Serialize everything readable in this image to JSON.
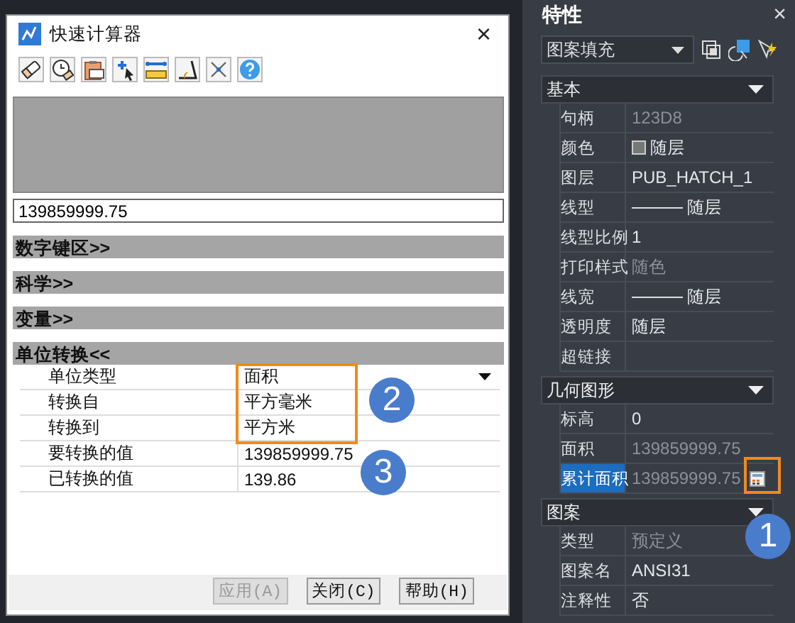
{
  "calculator": {
    "title": "快速计算器",
    "close_glyph": "×",
    "display_value": "139859999.75",
    "sections": [
      {
        "label": "数字键区>>"
      },
      {
        "label": "科学>>"
      },
      {
        "label": "变量>>"
      },
      {
        "label": "单位转换<<",
        "rows": [
          {
            "label": "单位类型",
            "value": "面积",
            "kind": "dropdown"
          },
          {
            "label": "转换自",
            "value": "平方毫米",
            "kind": "text"
          },
          {
            "label": "转换到",
            "value": "平方米",
            "kind": "text"
          },
          {
            "label": "要转换的值",
            "value": "139859999.75",
            "kind": "text"
          },
          {
            "label": "已转换的值",
            "value": "139.86",
            "kind": "text"
          }
        ]
      }
    ],
    "buttons": [
      {
        "label": "应用(A)",
        "disabled": true
      },
      {
        "label": "关闭(C)",
        "disabled": false
      },
      {
        "label": "帮助(H)",
        "disabled": false
      }
    ]
  },
  "properties": {
    "title": "特性",
    "close_glyph": "×",
    "object_type": "图案填充",
    "groups": [
      {
        "title": "基本",
        "rows": [
          {
            "label": "句柄",
            "value": "123D8",
            "kind": "text",
            "disabled": true,
            "selected": false
          },
          {
            "label": "颜色",
            "value": "随层",
            "kind": "swatch",
            "disabled": false,
            "selected": false
          },
          {
            "label": "图层",
            "value": "PUB_HATCH_1",
            "kind": "text",
            "disabled": false,
            "selected": false
          },
          {
            "label": "线型",
            "value": "随层",
            "kind": "line",
            "disabled": false,
            "selected": false
          },
          {
            "label": "线型比例",
            "value": "1",
            "kind": "text",
            "disabled": false,
            "selected": false
          },
          {
            "label": "打印样式",
            "value": "随色",
            "kind": "text",
            "disabled": true,
            "selected": false
          },
          {
            "label": "线宽",
            "value": "随层",
            "kind": "line",
            "disabled": false,
            "selected": false
          },
          {
            "label": "透明度",
            "value": "随层",
            "kind": "text",
            "disabled": false,
            "selected": false
          },
          {
            "label": "超链接",
            "kind": "text",
            "selected": false
          }
        ]
      },
      {
        "title": "几何图形",
        "rows": [
          {
            "label": "标高",
            "value": "0",
            "kind": "text",
            "disabled": false,
            "selected": false
          },
          {
            "label": "面积",
            "value": "139859999.75",
            "kind": "text",
            "disabled": true,
            "selected": false
          },
          {
            "label": "累计面积",
            "value": "139859999.75",
            "kind": "calc",
            "disabled": true,
            "selected": true
          }
        ]
      },
      {
        "title": "图案",
        "rows": [
          {
            "label": "类型",
            "value": "预定义",
            "kind": "text",
            "disabled": true,
            "selected": false
          },
          {
            "label": "图案名",
            "value": "ANSI31",
            "kind": "text",
            "disabled": false,
            "selected": false
          },
          {
            "label": "注释性",
            "value": "否",
            "kind": "text",
            "disabled": false,
            "selected": false
          }
        ]
      }
    ]
  },
  "callouts": [
    "1",
    "2",
    "3"
  ]
}
